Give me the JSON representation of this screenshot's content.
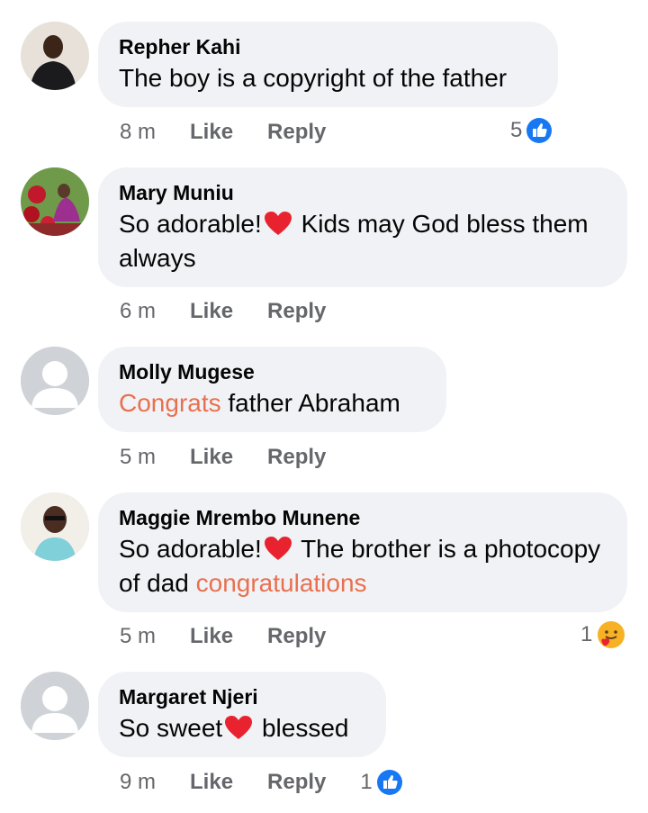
{
  "comments": [
    {
      "name": "Repher Kahi",
      "text": "The boy is a copyright of the father",
      "time": "8 m",
      "like_label": "Like",
      "reply_label": "Reply",
      "reaction_count": "5",
      "reaction_icon": "like-icon"
    },
    {
      "name": "Mary Muniu",
      "text_a": "So adorable!",
      "text_b": " Kids may God bless them always",
      "time": "6 m",
      "like_label": "Like",
      "reply_label": "Reply"
    },
    {
      "name": "Molly Mugese",
      "text_hl": "Congrats",
      "text_b": " father Abraham",
      "time": "5 m",
      "like_label": "Like",
      "reply_label": "Reply"
    },
    {
      "name": "Maggie Mrembo Munene",
      "text_a": "So adorable!",
      "text_b": " The brother is a photocopy of dad ",
      "text_hl": "congratulations",
      "time": "5 m",
      "like_label": "Like",
      "reply_label": "Reply",
      "reaction_count": "1",
      "reaction_icon": "care-icon"
    },
    {
      "name": "Margaret Njeri",
      "text_a": "So sweet",
      "text_b": " blessed",
      "time": "9 m",
      "like_label": "Like",
      "reply_label": "Reply",
      "reaction_count": "1",
      "reaction_icon": "like-icon"
    }
  ],
  "colors": {
    "bubble": "#f0f2f5",
    "highlight": "#e9704f",
    "meta": "#65676b",
    "like_blue": "#1877f2"
  }
}
